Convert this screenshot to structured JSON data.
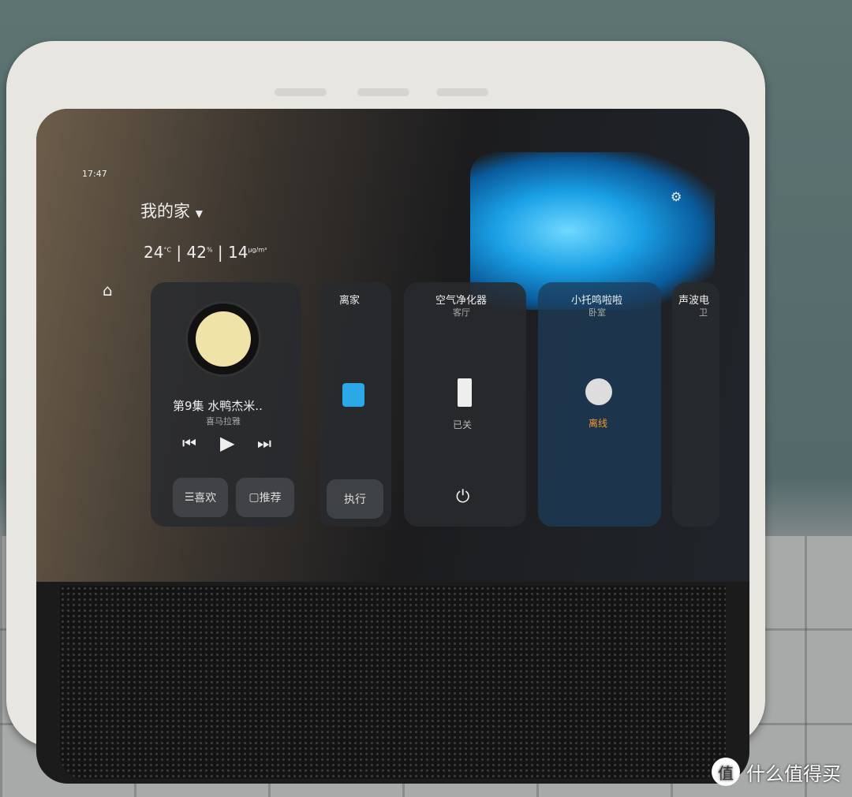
{
  "status": {
    "time": "17:47"
  },
  "home": {
    "title": "我的家",
    "temp": "24",
    "temp_unit": "°C",
    "humidity": "42",
    "humidity_unit": "%",
    "pm": "14",
    "pm_unit": "μg/m³"
  },
  "music": {
    "title": "第9集 水鸭杰米..",
    "source": "喜马拉雅",
    "like": "喜欢",
    "recommend": "推荐"
  },
  "scene": {
    "name": "离家",
    "action": "执行"
  },
  "purifier": {
    "name": "空气净化器",
    "room": "客厅",
    "status": "已关"
  },
  "vacuum": {
    "name": "小托鸣啦啦",
    "room": "卧室",
    "status": "离线"
  },
  "toothbrush": {
    "name": "声波电",
    "room": "卫"
  },
  "watermark": "什么值得买",
  "colors": {
    "offline": "#f39a2a",
    "scene_icon": "#2aa8e8"
  }
}
